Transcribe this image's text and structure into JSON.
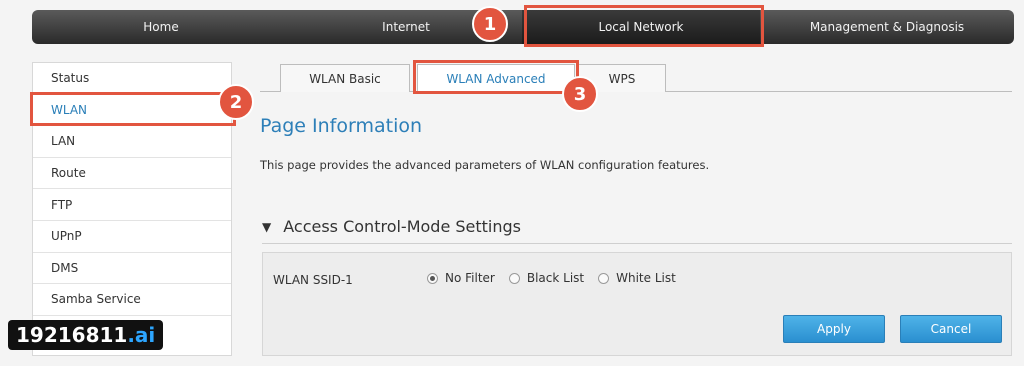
{
  "nav": {
    "home": "Home",
    "internet": "Internet",
    "local_network": "Local Network",
    "management": "Management & Diagnosis"
  },
  "sidebar": {
    "items": [
      {
        "label": "Status"
      },
      {
        "label": "WLAN"
      },
      {
        "label": "LAN"
      },
      {
        "label": "Route"
      },
      {
        "label": "FTP"
      },
      {
        "label": "UPnP"
      },
      {
        "label": "DMS"
      },
      {
        "label": "Samba Service"
      }
    ]
  },
  "tabs": {
    "basic": "WLAN Basic",
    "advanced": "WLAN Advanced",
    "wps": "WPS"
  },
  "badges": {
    "one": "1",
    "two": "2",
    "three": "3"
  },
  "page": {
    "title": "Page Information",
    "description": "This page provides the advanced parameters of WLAN configuration features."
  },
  "section": {
    "title": "Access Control-Mode Settings"
  },
  "form": {
    "ssid_label": "WLAN SSID-1",
    "options": [
      "No Filter",
      "Black List",
      "White List"
    ],
    "selected": "No Filter"
  },
  "buttons": {
    "apply": "Apply",
    "cancel": "Cancel"
  },
  "watermark": {
    "main": "19216811",
    "suffix": ".ai"
  },
  "colors": {
    "highlight": "#e2553f",
    "accent": "#2d7fb8"
  }
}
